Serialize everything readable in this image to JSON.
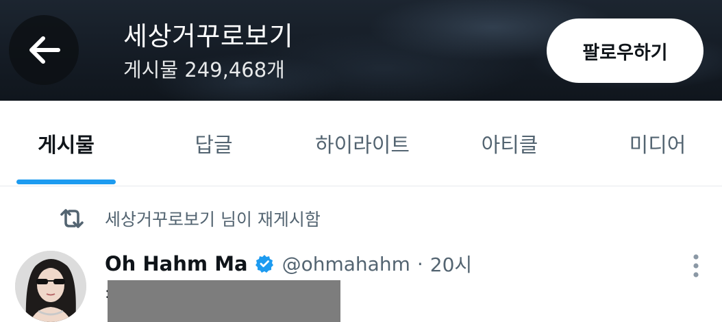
{
  "header": {
    "back_label": "←",
    "profile_name": "세상거꾸로보기",
    "post_count_text": "게시물 249,468개",
    "follow_button_label": "팔로우하기"
  },
  "tabs": [
    {
      "label": "게시물",
      "active": true
    },
    {
      "label": "답글",
      "active": false
    },
    {
      "label": "하이라이트",
      "active": false
    },
    {
      "label": "아티클",
      "active": false
    },
    {
      "label": "미디어",
      "active": false
    }
  ],
  "repost": {
    "icon": "repost-icon",
    "text": "세상거꾸로보기 님이 재게시함"
  },
  "tweet": {
    "display_name": "Oh Hahm Ma",
    "verified": true,
    "handle": "@ohmahahm",
    "separator": "·",
    "time": "20시",
    "body_prefix": ":"
  },
  "colors": {
    "accent": "#1d9bf0",
    "text_primary": "#0f1419",
    "text_secondary": "#536471",
    "banner": "#151c25",
    "redaction": "#7d7d7d"
  }
}
